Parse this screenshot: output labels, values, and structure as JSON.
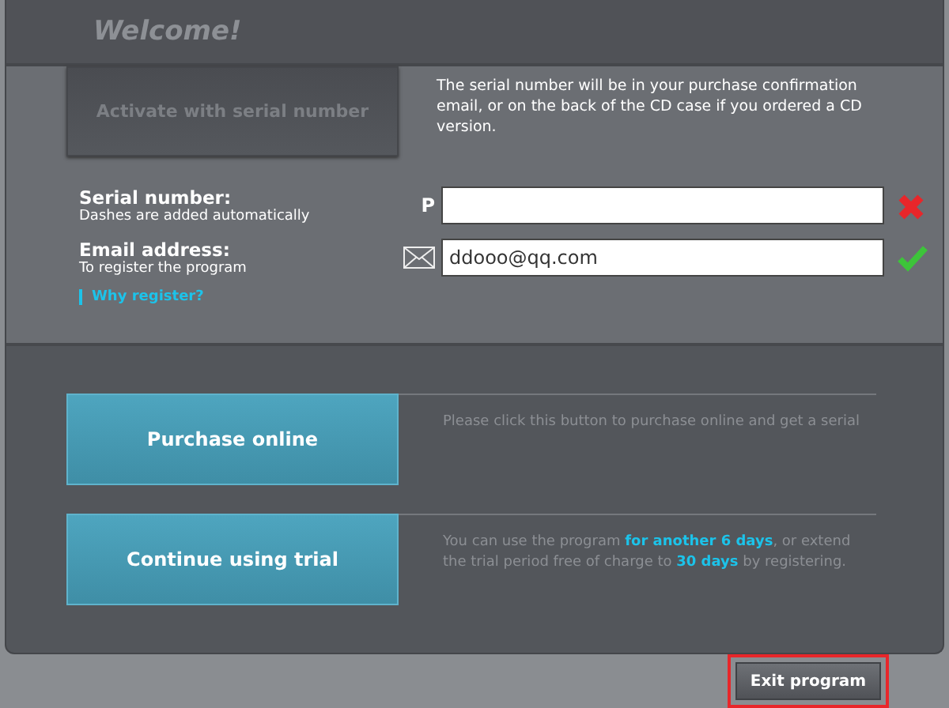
{
  "window": {
    "title": "Welcome!"
  },
  "activation": {
    "button": {
      "label": "Activate with serial number",
      "disabled": true
    },
    "info": "The serial number will be in your purchase confirmation email, or on the back of the CD case if you ordered a CD version."
  },
  "fields": [
    {
      "kind": "serial",
      "label": "Serial number:",
      "hint": "Dashes are added automatically",
      "prefix": "P",
      "valid": false
    },
    {
      "kind": "email",
      "label": "Email address:",
      "hint": "To register the program",
      "value": "ddooo@qq.com",
      "valid": true,
      "link": "Why register?"
    }
  ],
  "options": [
    {
      "button": "Purchase online",
      "text": "Please click this button to purchase online and get a serial"
    },
    {
      "button": "Continue using trial",
      "text": "You can use the program **for another 6 days**, or extend the trial period free of charge to **30 days** by registering."
    }
  ],
  "footer": {
    "button": "Exit program",
    "highlighted": true
  }
}
